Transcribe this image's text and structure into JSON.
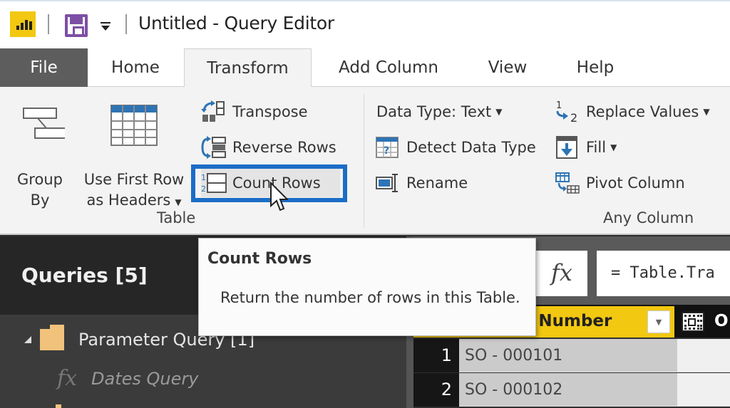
{
  "titlebar": {
    "app_icon": "power-bi-icon",
    "save_icon": "save-icon",
    "qat_icon": "customize-quick-access-icon",
    "title": "Untitled - Query Editor"
  },
  "tabs": [
    {
      "label": "File",
      "active": false
    },
    {
      "label": "Home",
      "active": false
    },
    {
      "label": "Transform",
      "active": true
    },
    {
      "label": "Add Column",
      "active": false
    },
    {
      "label": "View",
      "active": false
    },
    {
      "label": "Help",
      "active": false
    }
  ],
  "ribbon": {
    "table_group": {
      "label": "Table",
      "group_by": {
        "line1": "Group",
        "line2": "By",
        "icon": "group-by-icon"
      },
      "use_first_row": {
        "line1": "Use First Row",
        "line2": "as Headers",
        "icon": "table-headers-icon"
      },
      "transpose": {
        "label": "Transpose",
        "icon": "transpose-icon"
      },
      "reverse_rows": {
        "label": "Reverse Rows",
        "icon": "reverse-rows-icon"
      },
      "count_rows": {
        "label": "Count Rows",
        "icon": "count-rows-icon",
        "highlighted": true
      }
    },
    "any_column_group": {
      "label": "Any Column",
      "data_type": {
        "label": "Data Type: Text"
      },
      "detect_data_type": {
        "label": "Detect Data Type",
        "icon": "detect-data-type-icon"
      },
      "rename": {
        "label": "Rename",
        "icon": "rename-icon"
      },
      "replace_values": {
        "label": "Replace Values",
        "icon": "replace-values-icon"
      },
      "fill": {
        "label": "Fill",
        "icon": "fill-down-icon"
      },
      "pivot_column": {
        "label": "Pivot Column",
        "icon": "pivot-column-icon"
      }
    }
  },
  "tooltip": {
    "title": "Count Rows",
    "body": "Return the number of rows in this Table."
  },
  "queries": {
    "title": "Queries [5]",
    "items": [
      {
        "label": "Parameter Query [1]",
        "type": "folder",
        "expanded": true
      },
      {
        "label": "Dates Query",
        "type": "function"
      }
    ]
  },
  "formula_bar": {
    "fx_label": "fx",
    "value": "= Table.Tra"
  },
  "table": {
    "columns": [
      {
        "label": "Order Number",
        "visible_label": "r Number",
        "selected": true
      },
      {
        "label": "Or",
        "visible_label": "O"
      }
    ],
    "rows": [
      {
        "num": "1",
        "value": "SO - 000101"
      },
      {
        "num": "2",
        "value": "SO - 000102"
      }
    ]
  },
  "colors": {
    "accent_yellow": "#f2c811",
    "highlight_blue": "#1c6dc7",
    "save_purple": "#7d4fa4",
    "folder": "#f1c27b"
  }
}
